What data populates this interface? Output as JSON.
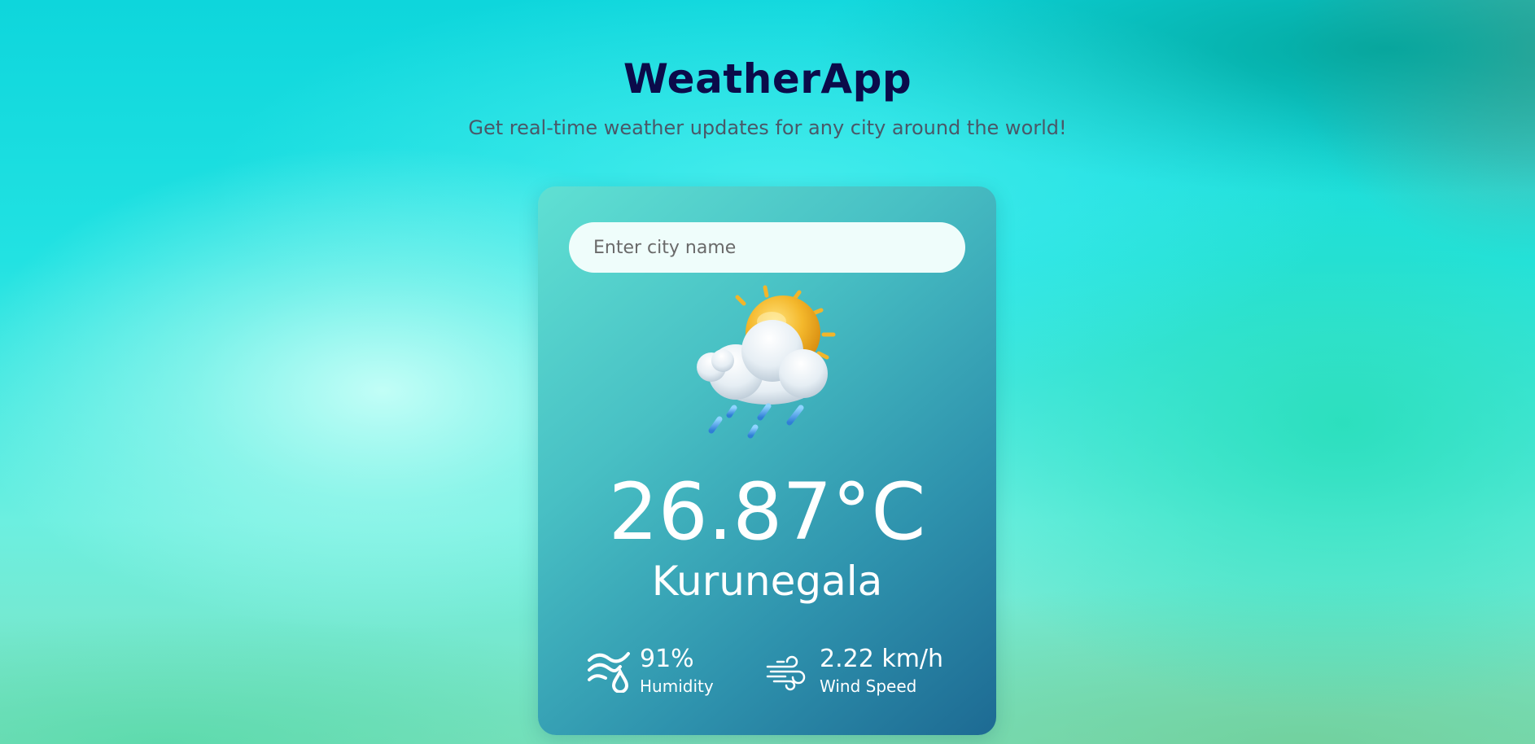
{
  "header": {
    "title": "WeatherApp",
    "subtitle": "Get real-time weather updates for any city around the world!"
  },
  "search": {
    "placeholder": "Enter city name",
    "value": ""
  },
  "weather": {
    "icon": "sun-cloud-rain-icon",
    "temperature": "26.87°C",
    "city": "Kurunegala"
  },
  "stats": {
    "humidity": {
      "icon": "humidity-icon",
      "value": "91%",
      "label": "Humidity"
    },
    "wind": {
      "icon": "wind-icon",
      "value": "2.22 km/h",
      "label": "Wind Speed"
    }
  },
  "colors": {
    "title": "#0b0b4a",
    "subtitle": "#4a5868",
    "card_start": "#5fe0d3",
    "card_end": "#1d6a93",
    "text_light": "#ffffff"
  }
}
